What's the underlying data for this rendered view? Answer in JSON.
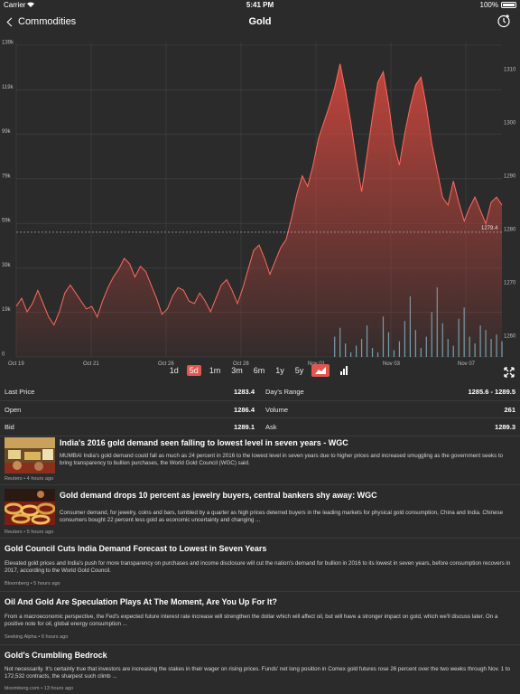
{
  "status": {
    "carrier": "Carrier",
    "time": "5:41 PM",
    "battery": "100%"
  },
  "nav": {
    "back_label": "Commodities",
    "title": "Gold"
  },
  "chart_data": {
    "type": "area",
    "title": "",
    "x_ticks": [
      "Oct 19",
      "Oct 21",
      "Oct 26",
      "Oct 28",
      "Nov 01",
      "Nov 03",
      "Nov 07"
    ],
    "price_ticks": [
      1310,
      1300,
      1290,
      1280,
      1270,
      1260
    ],
    "volume_ticks": [
      "139k",
      "119k",
      "99k",
      "79k",
      "59k",
      "39k",
      "19k",
      "0"
    ],
    "price_ylim": [
      1256,
      1315
    ],
    "current_price_label": "1279.4",
    "current_price": 1279.4,
    "price_series": [
      1265.5,
      1267.0,
      1264.5,
      1266.0,
      1268.5,
      1266.0,
      1263.5,
      1262.0,
      1264.5,
      1268.0,
      1269.5,
      1268.0,
      1266.5,
      1265.0,
      1265.5,
      1263.5,
      1266.5,
      1269.0,
      1271.0,
      1272.5,
      1274.5,
      1273.5,
      1271.0,
      1273.0,
      1272.0,
      1269.5,
      1267.0,
      1264.0,
      1265.0,
      1267.5,
      1269.0,
      1268.5,
      1266.5,
      1266.0,
      1268.0,
      1266.5,
      1264.5,
      1267.0,
      1269.5,
      1270.5,
      1268.5,
      1266.0,
      1269.0,
      1272.5,
      1276.0,
      1277.0,
      1274.5,
      1271.5,
      1274.0,
      1276.5,
      1278.0,
      1282.0,
      1286.5,
      1290.0,
      1288.0,
      1292.0,
      1297.0,
      1300.0,
      1303.0,
      1306.5,
      1311.0,
      1306.0,
      1300.0,
      1293.0,
      1287.0,
      1294.0,
      1301.0,
      1307.5,
      1309.5,
      1303.5,
      1296.0,
      1292.0,
      1298.0,
      1303.0,
      1307.0,
      1308.5,
      1303.0,
      1296.0,
      1291.0,
      1286.0,
      1284.5,
      1289.0,
      1285.0,
      1281.5,
      1284.0,
      1286.0,
      1283.5,
      1281.0,
      1285.0,
      1286.0,
      1284.5
    ],
    "volume_series": [
      0,
      0,
      0,
      0,
      0,
      0,
      0,
      0,
      0,
      0,
      0,
      0,
      0,
      0,
      0,
      0,
      0,
      0,
      0,
      0,
      0,
      0,
      0,
      0,
      0,
      0,
      0,
      0,
      0,
      0,
      0,
      0,
      0,
      0,
      0,
      0,
      0,
      0,
      0,
      0,
      0,
      0,
      0,
      0,
      0,
      0,
      0,
      0,
      0,
      0,
      0,
      0,
      0,
      0,
      0,
      0,
      0,
      0,
      0,
      9,
      13,
      6,
      2,
      5,
      8,
      14,
      4,
      2,
      18,
      11,
      3,
      7,
      16,
      27,
      12,
      4,
      9,
      20,
      31,
      15,
      8,
      5,
      17,
      22,
      9,
      6,
      14,
      12,
      8,
      10,
      7
    ]
  },
  "ranges": {
    "options": [
      "1d",
      "5d",
      "1m",
      "3m",
      "6m",
      "1y",
      "5y"
    ],
    "selected": "5d"
  },
  "stats": {
    "last_price_label": "Last Price",
    "last_price": "1283.4",
    "days_range_label": "Day's Range",
    "days_range": "1285.6 - 1289.5",
    "open_label": "Open",
    "open": "1286.4",
    "volume_label": "Volume",
    "volume": "261",
    "bid_label": "Bid",
    "bid": "1289.1",
    "ask_label": "Ask",
    "ask": "1289.3"
  },
  "news": [
    {
      "title": "India's 2016 gold demand seen falling to lowest level in seven years - WGC",
      "summary": "MUMBAI India's gold demand could fall as much as 24 percent in 2016 to the lowest level in seven years due to higher prices and increased smuggling as the government seeks to bring transparency to bullion purchases, the World Gold Council (WGC) said.",
      "meta": "Reuters • 4 hours ago"
    },
    {
      "title": "Gold demand drops 10 percent as jewelry buyers, central bankers shy away: WGC",
      "summary": "Consumer demand, for jewelry, coins and bars, tumbled by a quarter as high prices deterred buyers in the leading markets for physical gold consumption, China and India. Chinese consumers bought 22 percent less gold as economic uncertainty and changing ...",
      "meta": "Reuters • 5 hours ago"
    },
    {
      "title": "Gold Council Cuts India Demand Forecast to Lowest in Seven Years",
      "summary": "Elevated gold prices and India's push for more transparency on purchases and income disclosure will cut the nation's demand for bullion in 2016 to its lowest in seven years, before consumption recovers in 2017, according to the World Gold Council.",
      "meta": "Bloomberg • 5 hours ago"
    },
    {
      "title": "Oil And Gold Are Speculation Plays At The Moment, Are You Up For It?",
      "summary": "From a macroeconomic perspective, the Fed's expected future interest rate increase will strengthen the dollar which will affect oil, but will have a stronger impact on gold, which we'll discuss later. On a positive note for oil, global energy consumption ...",
      "meta": "Seeking Alpha • 6 hours ago"
    },
    {
      "title": "Gold's Crumbling Bedrock",
      "summary": "Not necessarily. It's certainly true that investors are increasing the stakes in their wager on rising prices. Funds' net long position in Comex gold futures rose 26 percent over the two weeks through Nov. 1 to 172,532 contracts, the sharpest such climb ...",
      "meta": "bloomberg.com • 13 hours ago"
    }
  ],
  "colors": {
    "accent": "#e0574f",
    "background": "#2b2b2b",
    "volume": "#6fa8b8"
  }
}
